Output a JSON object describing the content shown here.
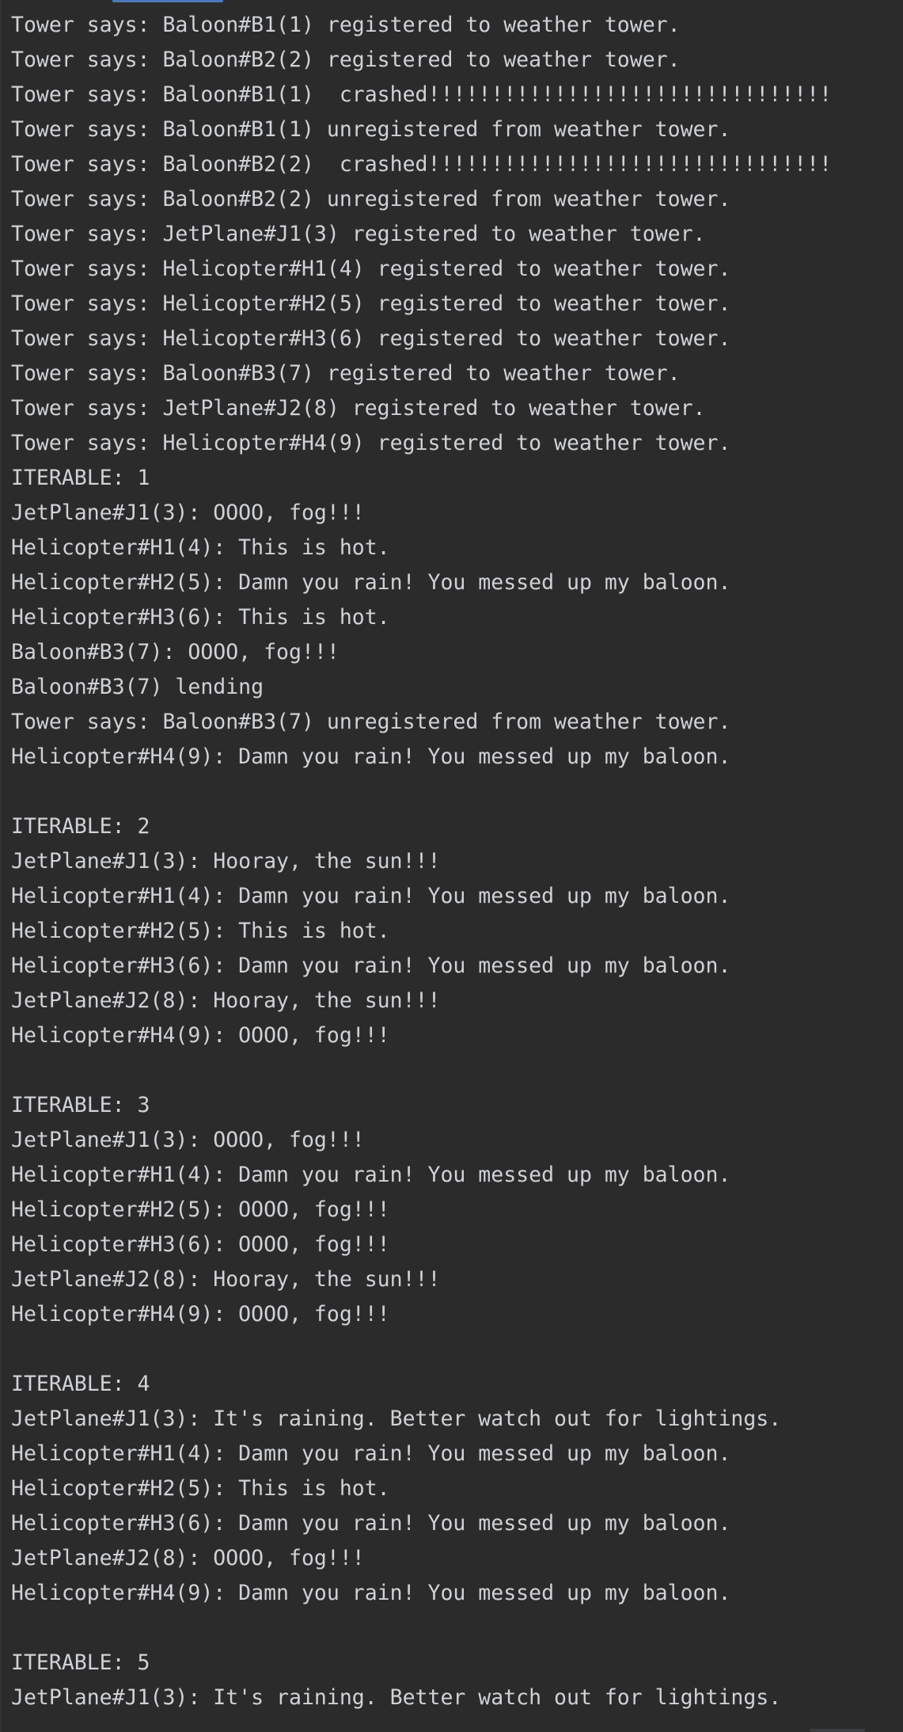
{
  "console": {
    "lines": [
      "Tower says: Baloon#B1(1) registered to weather tower.",
      "Tower says: Baloon#B2(2) registered to weather tower.",
      "Tower says: Baloon#B1(1)  crashed!!!!!!!!!!!!!!!!!!!!!!!!!!!!!!!!",
      "Tower says: Baloon#B1(1) unregistered from weather tower.",
      "Tower says: Baloon#B2(2)  crashed!!!!!!!!!!!!!!!!!!!!!!!!!!!!!!!!",
      "Tower says: Baloon#B2(2) unregistered from weather tower.",
      "Tower says: JetPlane#J1(3) registered to weather tower.",
      "Tower says: Helicopter#H1(4) registered to weather tower.",
      "Tower says: Helicopter#H2(5) registered to weather tower.",
      "Tower says: Helicopter#H3(6) registered to weather tower.",
      "Tower says: Baloon#B3(7) registered to weather tower.",
      "Tower says: JetPlane#J2(8) registered to weather tower.",
      "Tower says: Helicopter#H4(9) registered to weather tower.",
      "ITERABLE: 1",
      "JetPlane#J1(3): OOOO, fog!!!",
      "Helicopter#H1(4): This is hot.",
      "Helicopter#H2(5): Damn you rain! You messed up my baloon.",
      "Helicopter#H3(6): This is hot.",
      "Baloon#B3(7): OOOO, fog!!!",
      "Baloon#B3(7) lending",
      "Tower says: Baloon#B3(7) unregistered from weather tower.",
      "Helicopter#H4(9): Damn you rain! You messed up my baloon.",
      "",
      "ITERABLE: 2",
      "JetPlane#J1(3): Hooray, the sun!!!",
      "Helicopter#H1(4): Damn you rain! You messed up my baloon.",
      "Helicopter#H2(5): This is hot.",
      "Helicopter#H3(6): Damn you rain! You messed up my baloon.",
      "JetPlane#J2(8): Hooray, the sun!!!",
      "Helicopter#H4(9): OOOO, fog!!!",
      "",
      "ITERABLE: 3",
      "JetPlane#J1(3): OOOO, fog!!!",
      "Helicopter#H1(4): Damn you rain! You messed up my baloon.",
      "Helicopter#H2(5): OOOO, fog!!!",
      "Helicopter#H3(6): OOOO, fog!!!",
      "JetPlane#J2(8): Hooray, the sun!!!",
      "Helicopter#H4(9): OOOO, fog!!!",
      "",
      "ITERABLE: 4",
      "JetPlane#J1(3): It's raining. Better watch out for lightings.",
      "Helicopter#H1(4): Damn you rain! You messed up my baloon.",
      "Helicopter#H2(5): This is hot.",
      "Helicopter#H3(6): Damn you rain! You messed up my baloon.",
      "JetPlane#J2(8): OOOO, fog!!!",
      "Helicopter#H4(9): Damn you rain! You messed up my baloon.",
      "",
      "ITERABLE: 5",
      "JetPlane#J1(3): It's raining. Better watch out for lightings."
    ]
  },
  "colors": {
    "background": "#2b2b2b",
    "text": "#cfd2d6",
    "tab_indicator": "#4a7ab8"
  }
}
